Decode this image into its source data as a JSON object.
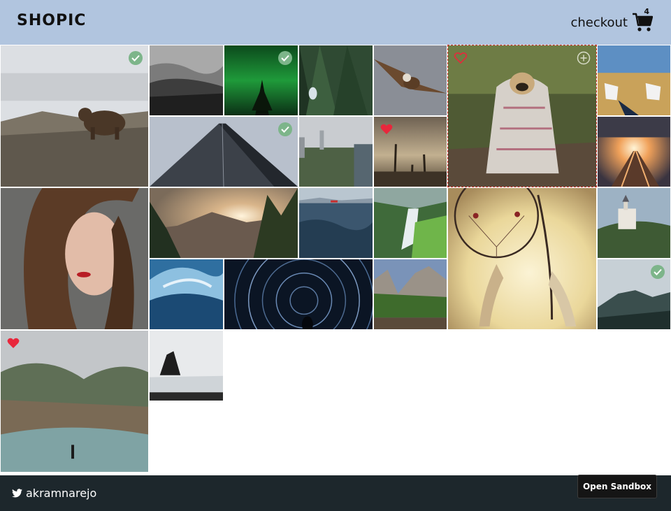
{
  "header": {
    "brand": "SHOPIC",
    "checkout_label": "checkout",
    "cart_count": "4",
    "cart_icon": "shopping-cart-icon"
  },
  "colors": {
    "header_bg": "#b1c5df",
    "footer_bg": "#1d272c",
    "check_badge": "#7db58a",
    "heart": "#e8273c"
  },
  "gallery": {
    "photos": [
      {
        "subject": "brown bear on rocks",
        "status": "in-cart"
      },
      {
        "subject": "misty forest black and white",
        "status": "none"
      },
      {
        "subject": "northern lights over tree",
        "status": "in-cart"
      },
      {
        "subject": "pine forest bird",
        "status": "none"
      },
      {
        "subject": "eagle in flight",
        "status": "none"
      },
      {
        "subject": "pug in blanket",
        "status": "selected",
        "icons": [
          "heart-outline-icon",
          "add-circle-icon"
        ]
      },
      {
        "subject": "sneakers in wheat field",
        "status": "none"
      },
      {
        "subject": "skyscraper looking up",
        "status": "in-cart"
      },
      {
        "subject": "city park skyline",
        "status": "none"
      },
      {
        "subject": "dead trees at sunset",
        "status": "favorited"
      },
      {
        "subject": "railway at sunset",
        "status": "none"
      },
      {
        "subject": "woman portrait",
        "status": "none"
      },
      {
        "subject": "mountain valley sunrise",
        "status": "none"
      },
      {
        "subject": "lake with red boat",
        "status": "none"
      },
      {
        "subject": "waterfall with moss",
        "status": "none"
      },
      {
        "subject": "dreamcatcher",
        "status": "none"
      },
      {
        "subject": "castle on hill",
        "status": "none"
      },
      {
        "subject": "ocean wave",
        "status": "none"
      },
      {
        "subject": "star trails",
        "status": "none"
      },
      {
        "subject": "yosemite valley river",
        "status": "none"
      },
      {
        "subject": "foggy mountain peak",
        "status": "in-cart"
      },
      {
        "subject": "river in misty valley",
        "status": "favorited"
      },
      {
        "subject": "sea stack on black beach",
        "status": "none"
      }
    ]
  },
  "footer": {
    "twitter_handle": "akramnarejo",
    "twitter_icon": "twitter-bird-icon",
    "sandbox_button": "Open Sandbox"
  }
}
